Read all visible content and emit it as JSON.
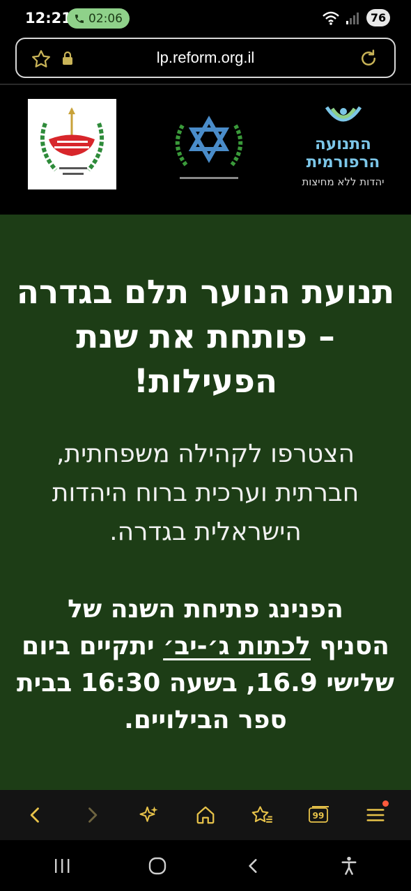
{
  "status_bar": {
    "time": "12:21",
    "call_timer": "02:06",
    "battery": "76"
  },
  "browser": {
    "url": "lp.reform.org.il"
  },
  "logos": {
    "reform_name_line1": "התנועה",
    "reform_name_line2": "הרפורמית",
    "reform_tagline": "יהדות ללא מחיצות"
  },
  "content": {
    "headline_line1": "תנועת הנוער תלם בגדרה",
    "headline_line2": "– פותחת את שנת",
    "headline_line3": "הפעילות!",
    "subtext_line1": "הצטרפו לקהילה משפחתית,",
    "subtext_line2": "חברתית וערכית ברוח היהדות",
    "subtext_line3": "הישראלית בגדרה.",
    "details_line1": "הפנינג פתיחת השנה של",
    "details_line2_start": "הסניף ",
    "details_line2_link": "לכתות ג׳-יב׳",
    "details_line2_end": " יתקיים ביום",
    "details_line3": "שלישי 16.9, בשעה 16:30 בבית",
    "details_line4": "ספר הבילויים."
  },
  "colors": {
    "content_bg": "#1d3d16",
    "call_pill": "#8fd18a",
    "accent_gold": "#e8c34a",
    "reform_blue": "#7cc6e8"
  },
  "icons": {
    "bottom_nav": [
      "back-icon",
      "forward-icon",
      "sparkle-icon",
      "home-icon",
      "bookmark-star-icon",
      "tabs-icon",
      "menu-icon"
    ],
    "tabs_count": "99"
  }
}
